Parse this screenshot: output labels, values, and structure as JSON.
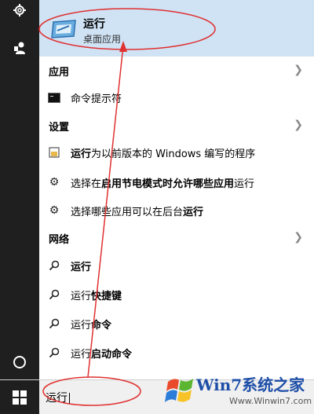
{
  "rail": {
    "icons": [
      "gear-icon",
      "user-icon",
      "cortana-icon"
    ]
  },
  "best_match": {
    "title": "运行",
    "subtitle": "桌面应用",
    "icon": "run-app-icon"
  },
  "sections": {
    "apps": {
      "header": "应用",
      "items": [
        {
          "label": "命令提示符",
          "icon": "cmd-icon"
        }
      ]
    },
    "settings": {
      "header": "设置",
      "items": [
        {
          "bold": "运行",
          "rest": "为以前版本的 Windows 编写的程序",
          "icon": "compat-icon"
        },
        {
          "prefix": "选择在",
          "bold": "启用节电模式时允许哪些应用",
          "rest": "运行",
          "icon": "gear-icon"
        },
        {
          "prefix": "选择哪些应用可以在后台",
          "bold": "运行",
          "rest": "",
          "icon": "gear-icon"
        }
      ]
    },
    "web": {
      "header": "网络",
      "items": [
        {
          "bold": "运行",
          "rest": "",
          "icon": "search-icon"
        },
        {
          "bold": "运行",
          "rest": "快捷键",
          "icon": "search-icon"
        },
        {
          "bold": "运行",
          "rest": "命令",
          "icon": "search-icon"
        },
        {
          "bold": "运行",
          "rest": "启动命令",
          "icon": "search-icon"
        }
      ]
    }
  },
  "taskbar": {
    "search_text": "运行"
  },
  "watermark": {
    "brand": "Win7系统之家",
    "url": "Www.Winwin7.com"
  },
  "colors": {
    "highlight": "#cfe3f5",
    "rail": "#1f1f1f",
    "annotation": "#e03030",
    "brand": "#1e4fa8"
  }
}
